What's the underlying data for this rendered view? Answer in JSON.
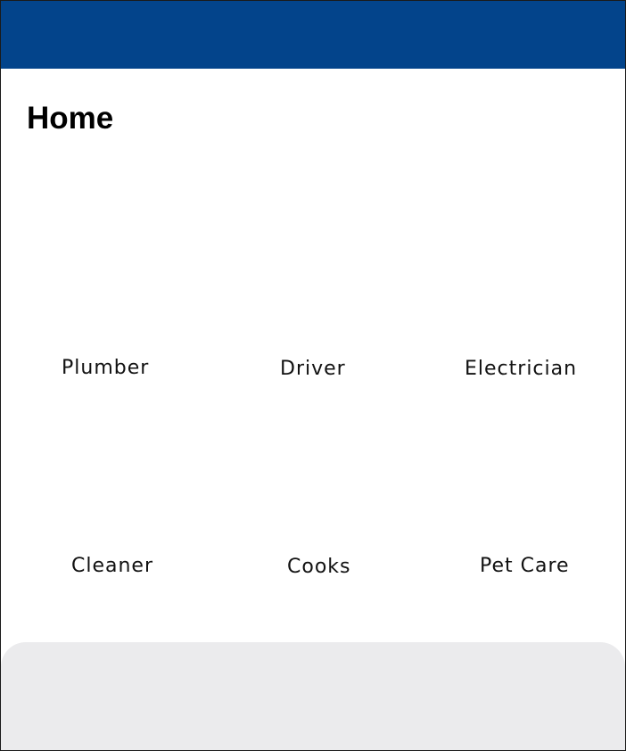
{
  "header": {
    "background_color": "#03448b"
  },
  "page": {
    "title": "Home"
  },
  "services": {
    "items": [
      {
        "label": "Plumber"
      },
      {
        "label": "Driver"
      },
      {
        "label": "Electrician"
      },
      {
        "label": "Cleaner"
      },
      {
        "label": "Cooks"
      },
      {
        "label": "Pet Care"
      }
    ]
  },
  "bottom_panel": {
    "background_color": "#ebebed"
  }
}
